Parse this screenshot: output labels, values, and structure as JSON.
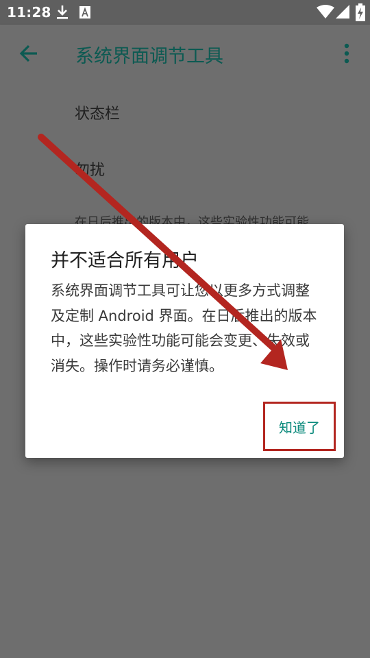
{
  "status_bar": {
    "time": "11:28",
    "icons": [
      "download-icon",
      "font-a-icon",
      "wifi-icon",
      "signal-icon",
      "battery-charging-icon"
    ]
  },
  "app_bar": {
    "title": "系统界面调节工具",
    "back_icon": "arrow-back-icon",
    "menu_icon": "more-vert-icon"
  },
  "preferences": {
    "items": [
      {
        "label": "状态栏"
      },
      {
        "label": "勿扰"
      }
    ],
    "summary": "在日后推出的版本中，这些实验性功能可能"
  },
  "dialog": {
    "title": "并不适合所有用户",
    "message": "系统界面调节工具可让您以更多方式调整及定制 Android 界面。在日后推出的版本中，这些实验性功能可能会变更、失效或消失。操作时请务必谨慎。",
    "button_label": "知道了"
  },
  "colors": {
    "accent": "#0b8a7c",
    "title_teal": "#0c5a52",
    "annotation_red": "#b32620",
    "scrim": "#6e6e6e"
  }
}
